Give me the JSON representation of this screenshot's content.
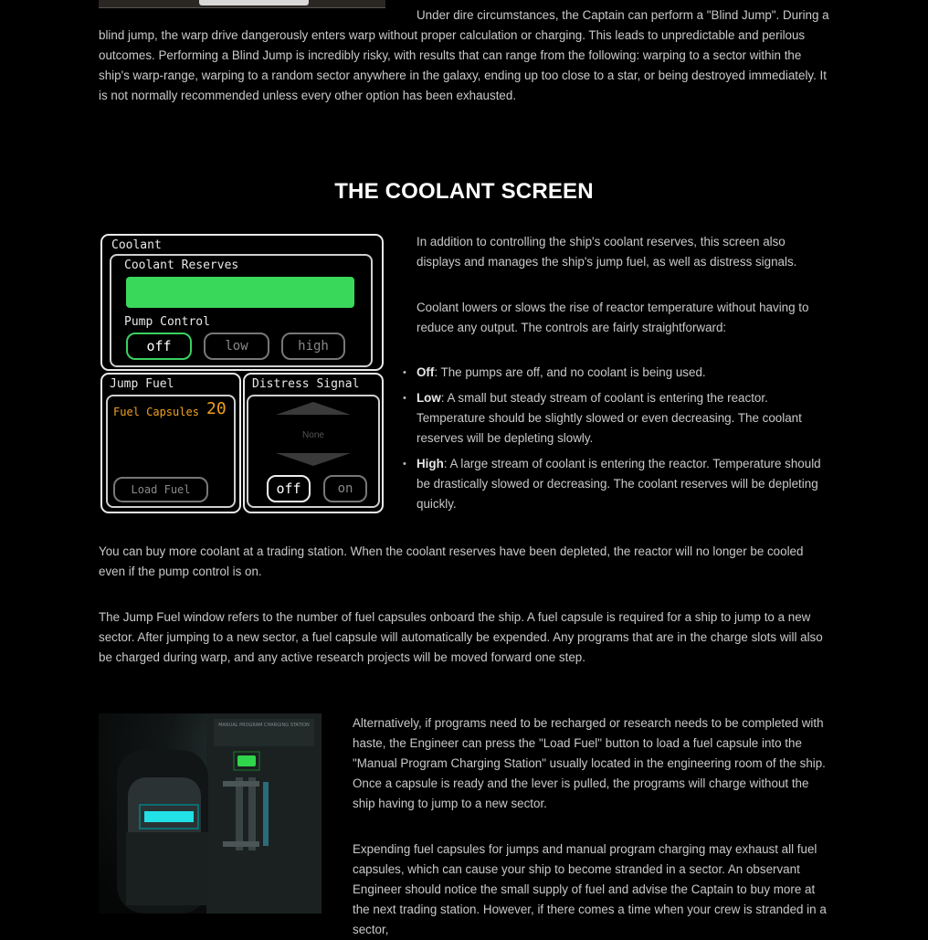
{
  "blind_jump": {
    "text": "Under dire circumstances, the Captain can perform a \"Blind Jump\". During a blind jump, the warp drive dangerously enters warp without proper calculation or charging. This leads to unpredictable and perilous outcomes. Performing a Blind Jump is incredibly risky, with results that can range from the following: warping to a sector within the ship's warp-range, warping to a random sector anywhere in the galaxy, ending up too close to a star, or being destroyed immediately. It is not normally recommended unless every other option has been exhausted."
  },
  "section": {
    "title": "THE COOLANT SCREEN"
  },
  "coolant_ui": {
    "panel_title": "Coolant",
    "reserves_label": "Coolant Reserves",
    "reserves_fill": 1.0,
    "pump_label": "Pump Control",
    "pump_options": [
      "off",
      "low",
      "high"
    ],
    "pump_selected": "off",
    "jump_fuel_title": "Jump Fuel",
    "fuel_capsules_label": "Fuel Capsules",
    "fuel_capsules_count": "20",
    "load_fuel_label": "Load Fuel",
    "distress_title": "Distress Signal",
    "distress_value": "None",
    "distress_options": [
      "off",
      "on"
    ],
    "distress_selected": "off",
    "colors": {
      "green": "#39d85a",
      "orange": "#f0a020"
    }
  },
  "intro": {
    "p1": "In addition to controlling the ship's coolant reserves, this screen also displays and manages the ship's jump fuel, as well as distress signals.",
    "p2": "Coolant lowers or slows the rise of reactor temperature without having to reduce any output. The controls are fairly straightforward:"
  },
  "levels": [
    {
      "term": "Off",
      "desc": ": The pumps are off, and no coolant is being used."
    },
    {
      "term": "Low",
      "desc": ": A small but steady stream of coolant is entering the reactor. Temperature should be slightly slowed or even decreasing. The coolant reserves will be depleting slowly."
    },
    {
      "term": "High",
      "desc": ": A large stream of coolant is entering the reactor. Temperature should be drastically slowed or decreasing. The coolant reserves will be depleting quickly."
    }
  ],
  "body": {
    "p_buy": "You can buy more coolant at a trading station. When the coolant reserves have been depleted, the reactor will no longer be cooled even if the pump control is on.",
    "p_fuel": "The Jump Fuel window refers to the number of fuel capsules onboard the ship. A fuel capsule is required for a ship to jump to a new sector. After jumping to a new sector, a fuel capsule will automatically be expended. Any programs that are in the charge slots will also be charged during warp, and any active research projects will be moved forward one step.",
    "p_alt": "Alternatively, if programs need to be recharged or research needs to be completed with haste, the Engineer can press the \"Load Fuel\" button to load a fuel capsule into the \"Manual Program Charging Station\" usually located in the engineering room of the ship. Once a capsule is ready and the lever is pulled, the programs will charge without the ship having to jump to a new sector.",
    "p_expend": "Expending fuel capsules for jumps and manual program charging may exhaust all fuel capsules, which can cause your ship to become stranded in a sector. An observant Engineer should notice the small supply of fuel and advise the Captain to buy more at the next trading station. However, if there comes a time when your crew is stranded in a sector,"
  },
  "photo": {
    "sign_text": "MANUAL PROGRAM CHARGING STATION"
  }
}
